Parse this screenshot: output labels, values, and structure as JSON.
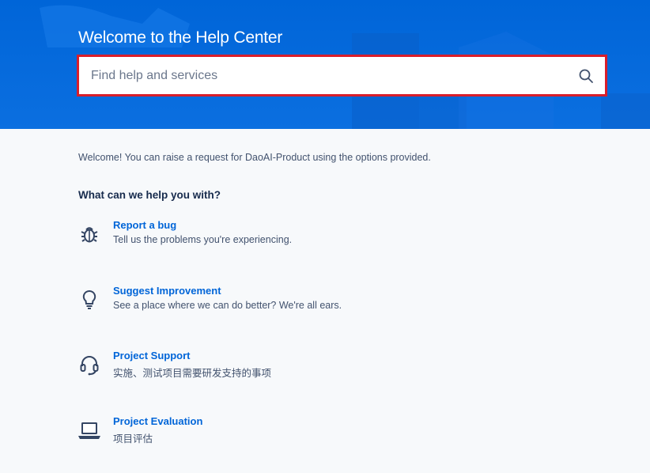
{
  "hero": {
    "title": "Welcome to the Help Center"
  },
  "search": {
    "placeholder": "Find help and services",
    "value": ""
  },
  "welcome_text": "Welcome! You can raise a request for DaoAI-Product using the options provided.",
  "section_title": "What can we help you with?",
  "options": [
    {
      "name": "Report a bug",
      "description": "Tell us the problems you're experiencing.",
      "icon": "bug-icon"
    },
    {
      "name": "Suggest Improvement",
      "description": "See a place where we can do better? We're all ears.",
      "icon": "lightbulb-icon"
    },
    {
      "name": "Project Support",
      "description": "实施、测试项目需要研发支持的事项",
      "icon": "headset-icon"
    },
    {
      "name": "Project Evaluation",
      "description": "项目评估",
      "icon": "laptop-icon"
    }
  ],
  "colors": {
    "hero_bg": "#0065d8",
    "link": "#0065d8",
    "search_highlight": "#d91e2b",
    "page_bg": "#f7f9fb"
  }
}
